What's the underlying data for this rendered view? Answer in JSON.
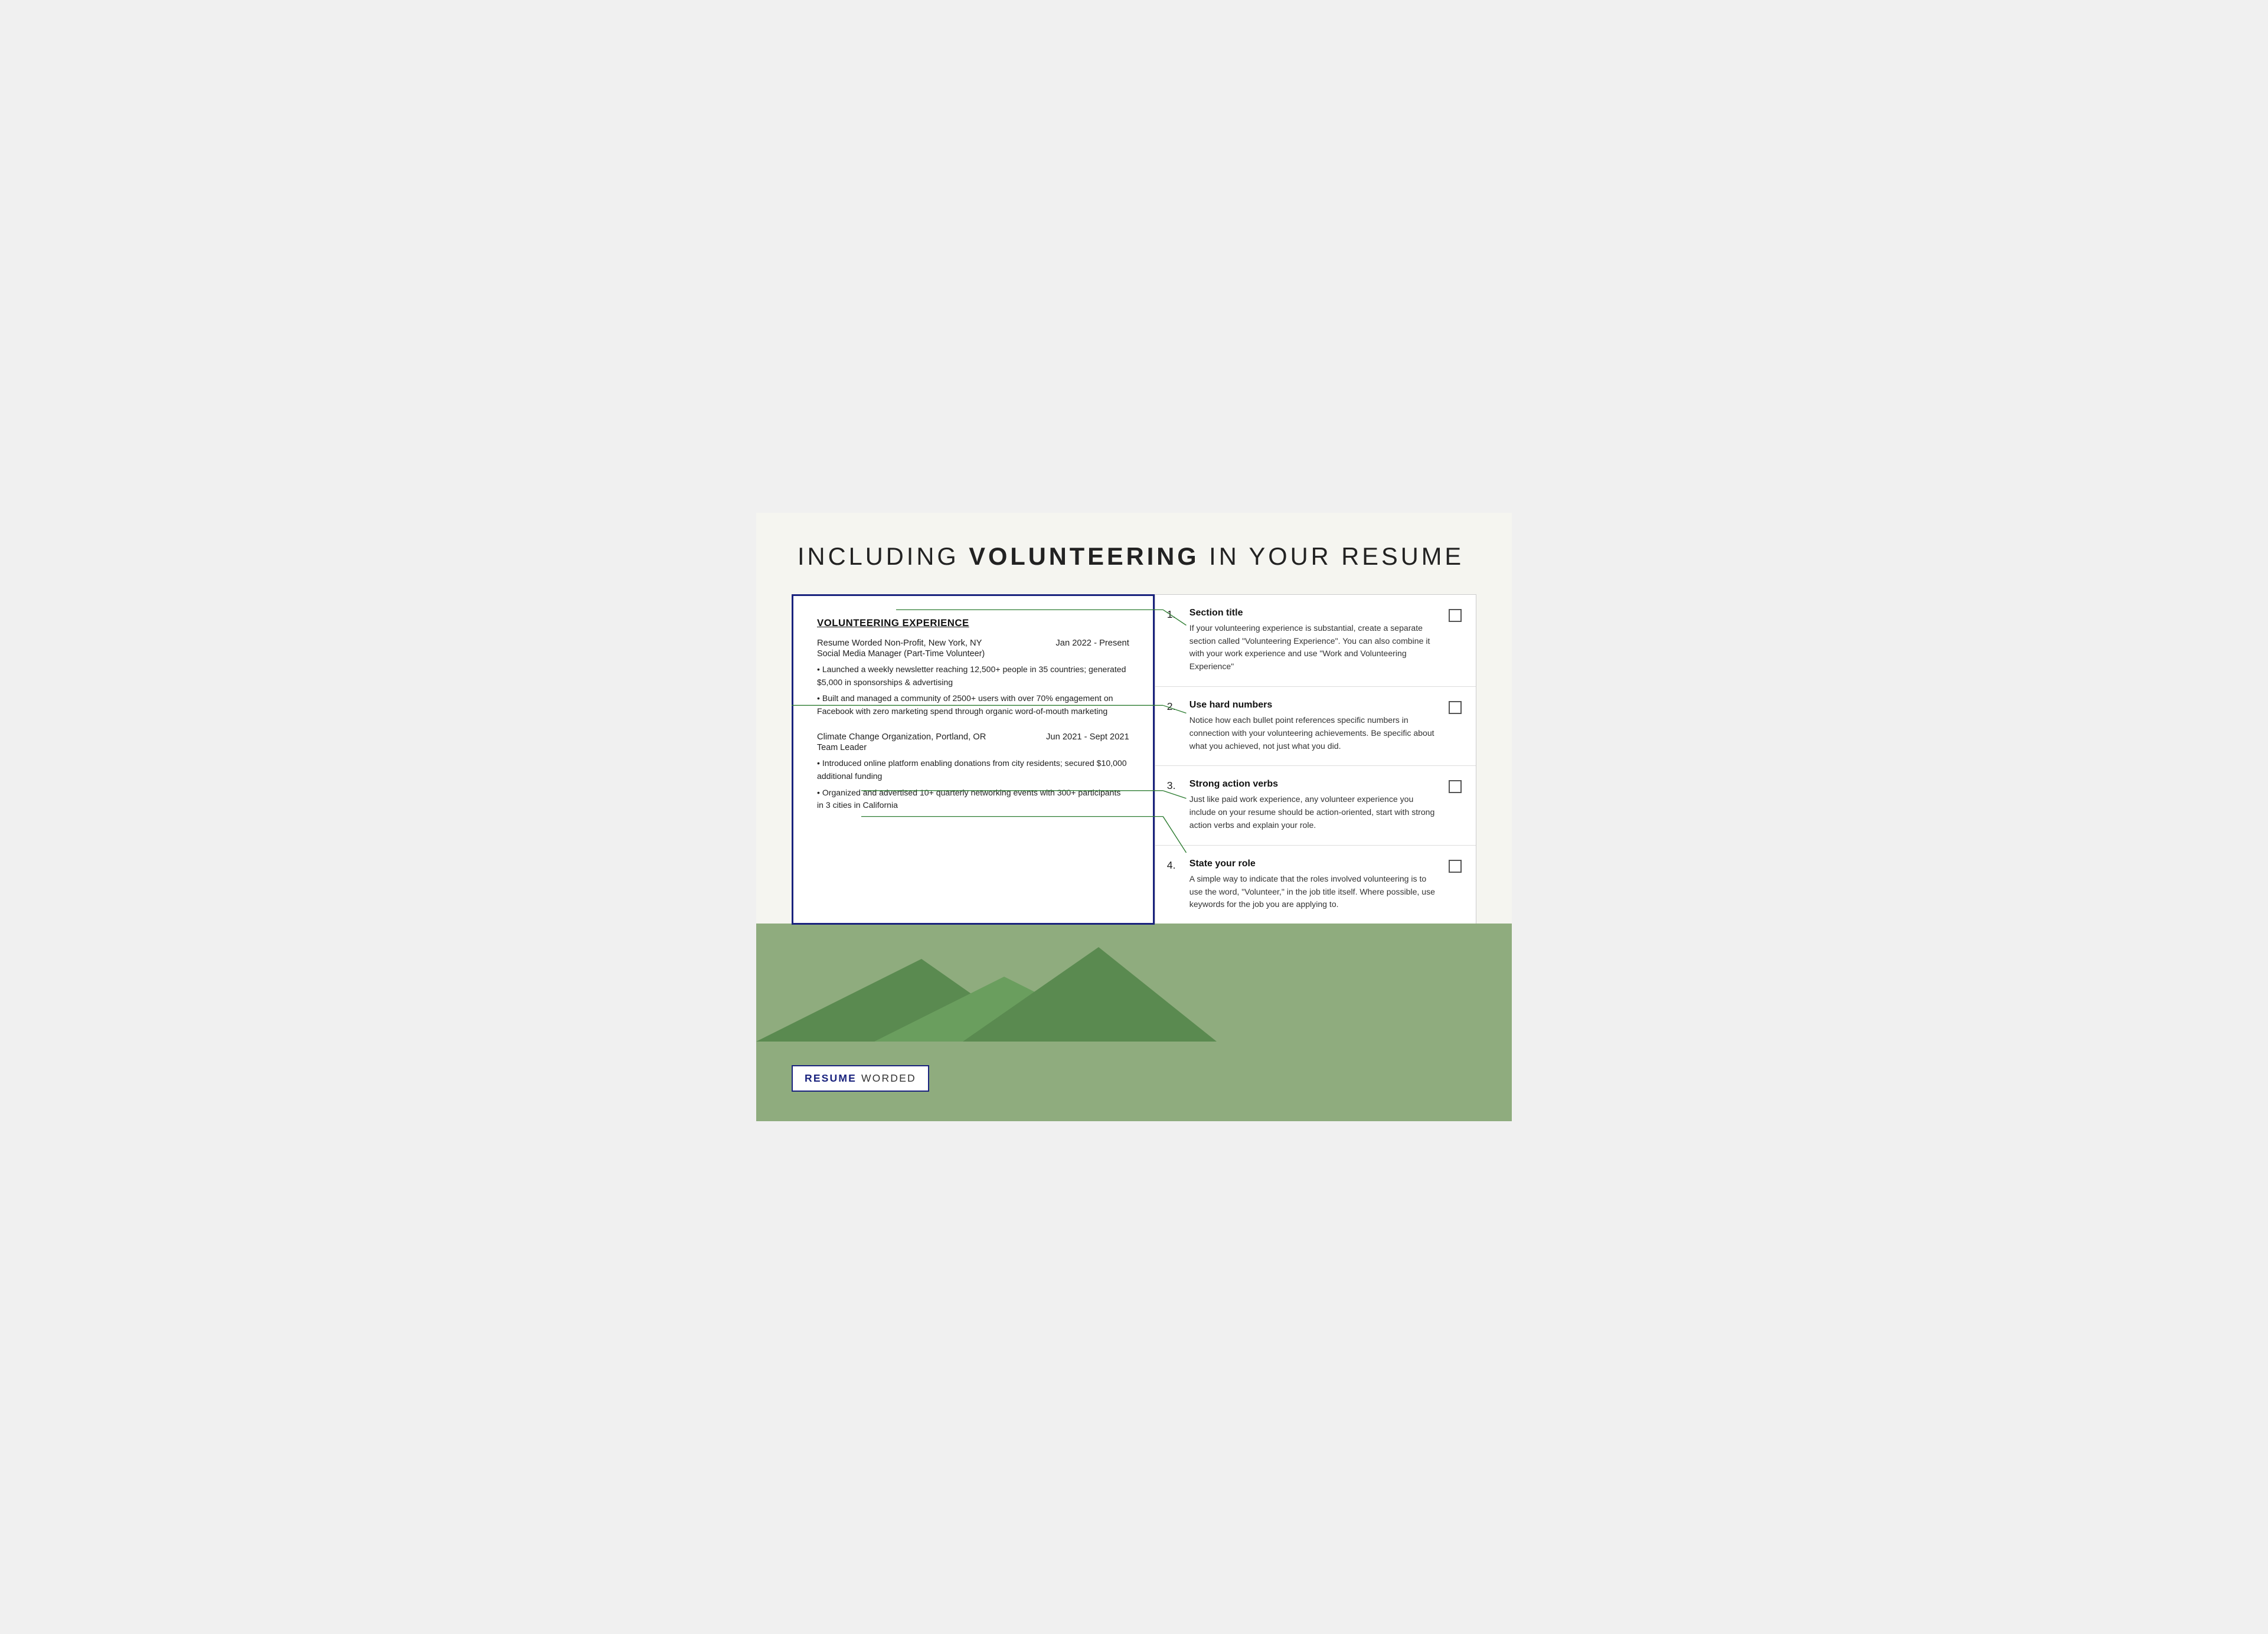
{
  "page": {
    "title_prefix": "INCLUDING ",
    "title_bold": "VOLUNTEERING",
    "title_suffix": " IN YOUR RESUME"
  },
  "resume": {
    "section_title": "VOLUNTEERING EXPERIENCE",
    "entry1": {
      "org": "Resume Worded Non-Profit, New York, NY",
      "date": "Jan 2022 - Present",
      "role": "Social Media Manager (Part-Time Volunteer)",
      "bullets": [
        "• Launched a weekly newsletter reaching 12,500+ people in 35 countries; generated $5,000 in sponsorships & advertising",
        "• Built and managed a community of 2500+ users with over 70% engagement on Facebook with zero marketing spend through organic word-of-mouth marketing"
      ]
    },
    "entry2": {
      "org": "Climate Change Organization, Portland, OR",
      "date": "Jun 2021 - Sept 2021",
      "role": "Team Leader",
      "bullets": [
        "• Introduced online platform enabling donations from city residents; secured $10,000 additional funding",
        "• Organized and advertised 10+ quarterly networking events with 300+ participants in 3 cities in California"
      ]
    }
  },
  "checklist": {
    "items": [
      {
        "number": "1.",
        "title": "Section title",
        "desc": "If your volunteering experience is substantial, create a separate section called \"Volunteering Experience\". You can also combine it with your work experience and use \"Work and Volunteering Experience\""
      },
      {
        "number": "2.",
        "title": "Use hard numbers",
        "desc": "Notice how each bullet point references specific numbers in connection with your volunteering achievements. Be specific about what you achieved, not just what you did."
      },
      {
        "number": "3.",
        "title": "Strong action verbs",
        "desc": "Just like paid work experience, any volunteer experience you include on your resume should be action-oriented, start with strong action verbs and explain your role."
      },
      {
        "number": "4.",
        "title": "State your role",
        "desc": "A simple way to indicate that the roles involved volunteering is to use the word, \"Volunteer,\" in the job title itself. Where possible, use keywords for the job you are applying to."
      }
    ]
  },
  "brand": {
    "resume": "RESUME",
    "worded": "WORDED"
  },
  "colors": {
    "navy": "#1a237e",
    "green_dark": "#2e7d32",
    "green_medium": "#8fac7e",
    "green_light": "#a8c49a"
  }
}
